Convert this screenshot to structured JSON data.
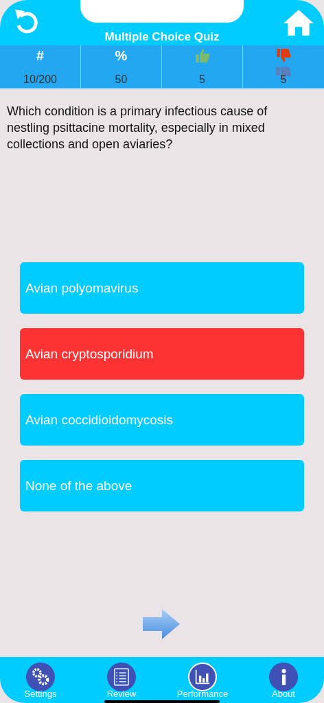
{
  "header": {
    "title": "Multiple Choice Quiz"
  },
  "stats": [
    {
      "kind": "text",
      "heading": "#",
      "value": "10/200"
    },
    {
      "kind": "text",
      "heading": "%",
      "value": "50"
    },
    {
      "kind": "thumbs-up",
      "value": "5"
    },
    {
      "kind": "thumbs-down",
      "value": "5"
    }
  ],
  "question": "Which condition is a primary infectious cause of nestling psittacine mortality, especially in mixed collections and open aviaries?",
  "answers": [
    {
      "label": "Avian polyomavirus",
      "selected": false
    },
    {
      "label": "Avian cryptosporidium",
      "selected": true
    },
    {
      "label": "Avian coccidioidomycosis",
      "selected": false
    },
    {
      "label": "None of the above",
      "selected": false
    }
  ],
  "tabs": [
    {
      "kind": "settings",
      "label": "Settings",
      "selected": false
    },
    {
      "kind": "review",
      "label": "Review",
      "selected": false
    },
    {
      "kind": "performance",
      "label": "Performance",
      "selected": true
    },
    {
      "kind": "about",
      "label": "About",
      "selected": false
    }
  ]
}
